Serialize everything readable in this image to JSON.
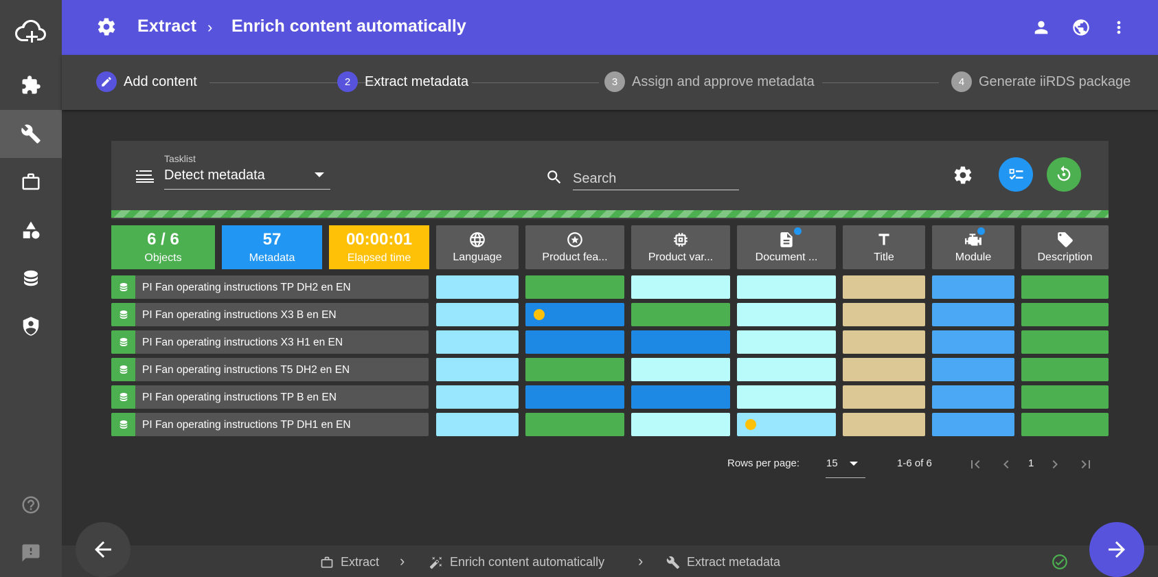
{
  "header": {
    "title": "Extract",
    "separator": "›",
    "subtitle": "Enrich content automatically"
  },
  "stepper": {
    "steps": [
      {
        "number": "",
        "label": "Add content",
        "state": "done"
      },
      {
        "number": "2",
        "label": "Extract metadata",
        "state": "active"
      },
      {
        "number": "3",
        "label": "Assign and approve metadata",
        "state": "pending"
      },
      {
        "number": "4",
        "label": "Generate iiRDS package",
        "state": "pending"
      }
    ]
  },
  "toolbar": {
    "tasklist_label": "Tasklist",
    "tasklist_value": "Detect metadata",
    "search_placeholder": "Search"
  },
  "stats": [
    {
      "value": "6 / 6",
      "label": "Objects",
      "color": "#4caf50"
    },
    {
      "value": "57",
      "label": "Metadata",
      "color": "#2196f3"
    },
    {
      "value": "00:00:01",
      "label": "Elapsed time",
      "color": "#ffc107"
    }
  ],
  "columns": [
    {
      "label": "Language",
      "icon": "globe-icon"
    },
    {
      "label": "Product fea...",
      "icon": "star-circle-icon"
    },
    {
      "label": "Product var...",
      "icon": "chip-icon"
    },
    {
      "label": "Document ...",
      "icon": "document-icon",
      "badge": true
    },
    {
      "label": "Title",
      "icon": "title-icon"
    },
    {
      "label": "Module",
      "icon": "engine-icon",
      "badge": true
    },
    {
      "label": "Description",
      "icon": "tag-icon"
    }
  ],
  "rows": [
    {
      "label": "PI Fan operating instructions TP DH2 en EN"
    },
    {
      "label": "PI Fan operating instructions X3 B en EN"
    },
    {
      "label": "PI Fan operating instructions X3 H1 en EN"
    },
    {
      "label": "PI Fan operating instructions T5 DH2 en EN"
    },
    {
      "label": "PI Fan operating instructions TP B en EN"
    },
    {
      "label": "PI Fan operating instructions TP DH1 en EN"
    }
  ],
  "cell_colors": {
    "light_blue": "#99e6ff",
    "green": "#4caf50",
    "pale_cyan": "#b9fbfb",
    "blue": "#1e88e5",
    "tan": "#dcc894",
    "mid_blue": "#4aa8f5"
  },
  "grid": [
    [
      "light_blue",
      "green",
      "pale_cyan",
      "pale_cyan",
      "tan",
      "mid_blue",
      "green"
    ],
    [
      "light_blue",
      "blue",
      "green",
      "pale_cyan",
      "tan",
      "mid_blue",
      "green"
    ],
    [
      "light_blue",
      "blue",
      "blue",
      "pale_cyan",
      "tan",
      "mid_blue",
      "green"
    ],
    [
      "light_blue",
      "green",
      "pale_cyan",
      "pale_cyan",
      "tan",
      "mid_blue",
      "green"
    ],
    [
      "light_blue",
      "blue",
      "blue",
      "pale_cyan",
      "tan",
      "mid_blue",
      "green"
    ],
    [
      "light_blue",
      "green",
      "pale_cyan",
      "light_blue",
      "tan",
      "mid_blue",
      "green"
    ]
  ],
  "markers": [
    [
      1,
      1
    ],
    [
      5,
      3
    ]
  ],
  "pagination": {
    "rows_per_page_label": "Rows per page:",
    "rows_per_page_value": "15",
    "range": "1-6 of 6",
    "page": "1"
  },
  "footer": {
    "breadcrumb": [
      "Extract",
      "Enrich content automatically",
      "Extract metadata"
    ]
  },
  "colors": {
    "accent": "#5753dc",
    "green": "#4caf50",
    "blue": "#2196f3"
  }
}
